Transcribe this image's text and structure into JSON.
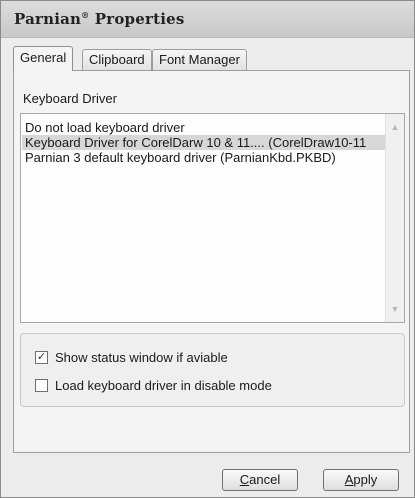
{
  "window": {
    "title_main": "Parnian",
    "title_mark": "®",
    "title_rest": " Properties"
  },
  "tabs": [
    {
      "label": "General",
      "active": true
    },
    {
      "label": "Clipboard",
      "active": false
    },
    {
      "label": "Font Manager",
      "active": false
    }
  ],
  "general": {
    "group_label": "Keyboard Driver",
    "list_items": [
      {
        "label": "Do not load keyboard driver",
        "selected": false
      },
      {
        "label": "Keyboard Driver for CorelDarw 10 & 11.... (CorelDraw10-11",
        "selected": true
      },
      {
        "label": "Parnian 3 default keyboard driver (ParnianKbd.PKBD)",
        "selected": false
      }
    ],
    "scroll_up_icon": "▲",
    "scroll_down_icon": "▼",
    "options": [
      {
        "label": "Show status window if aviable",
        "checked": true,
        "check_glyph": "✓"
      },
      {
        "label": "Load keyboard driver in disable mode",
        "checked": false,
        "check_glyph": ""
      }
    ]
  },
  "buttons": {
    "cancel_underline": "C",
    "cancel_rest": "ancel",
    "apply_underline": "A",
    "apply_rest": "pply"
  }
}
